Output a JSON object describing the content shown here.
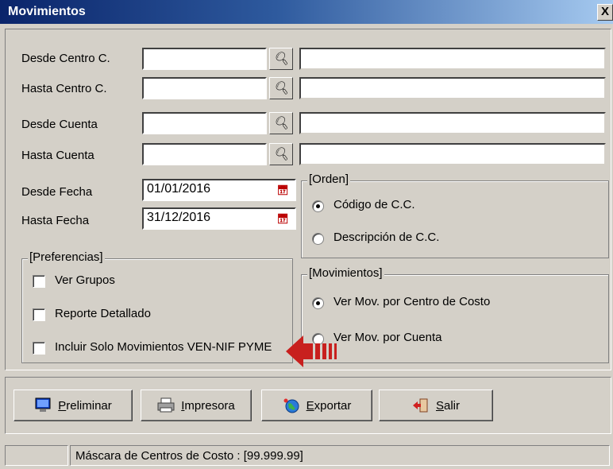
{
  "window": {
    "title": "Movimientos",
    "close_label": "X"
  },
  "filters": {
    "desde_centro": {
      "label": "Desde Centro C.",
      "value": ""
    },
    "hasta_centro": {
      "label": "Hasta Centro C.",
      "value": ""
    },
    "desde_cuenta": {
      "label": "Desde Cuenta",
      "value": ""
    },
    "hasta_cuenta": {
      "label": "Hasta Cuenta",
      "value": ""
    },
    "desde_fecha": {
      "label": "Desde Fecha",
      "value": "01/01/2016"
    },
    "hasta_fecha": {
      "label": "Hasta Fecha",
      "value": "31/12/2016"
    }
  },
  "orden": {
    "title": "[Orden]",
    "options": [
      {
        "label": "Código de C.C.",
        "selected": true
      },
      {
        "label": "Descripción de C.C.",
        "selected": false
      }
    ]
  },
  "movimientos": {
    "title": "[Movimientos]",
    "options": [
      {
        "label": "Ver Mov. por Centro de Costo",
        "selected": true
      },
      {
        "label": "Ver Mov. por Cuenta",
        "selected": false
      }
    ]
  },
  "preferencias": {
    "title": "[Preferencias]",
    "options": [
      {
        "label": "Ver Grupos",
        "checked": false
      },
      {
        "label": "Reporte Detallado",
        "checked": false
      },
      {
        "label": "Incluir Solo Movimientos VEN-NIF PYME",
        "checked": false
      }
    ]
  },
  "buttons": {
    "preliminar": {
      "underline": "P",
      "rest": "reliminar"
    },
    "impresora": {
      "underline": "I",
      "rest": "mpresora"
    },
    "exportar": {
      "underline": "E",
      "rest": "xportar"
    },
    "salir": {
      "underline": "S",
      "rest": "alir"
    }
  },
  "status": {
    "text": "Máscara de Centros de Costo : [99.999.99]"
  },
  "colors": {
    "face": "#d4d0c8",
    "title_start": "#0a246a",
    "title_end": "#a6caf0",
    "arrow": "#c8201e"
  }
}
